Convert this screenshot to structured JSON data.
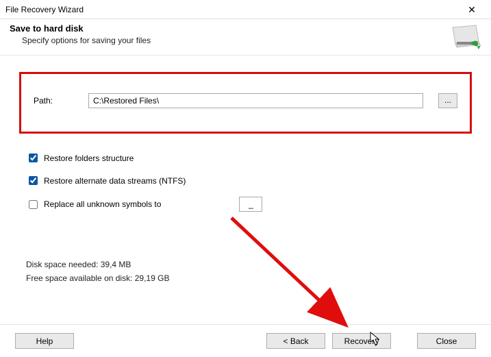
{
  "window": {
    "title": "File Recovery Wizard"
  },
  "header": {
    "title": "Save to hard disk",
    "subtitle": "Specify options for saving your files"
  },
  "path": {
    "label": "Path:",
    "value": "C:\\Restored Files\\",
    "browse_label": "..."
  },
  "options": {
    "restore_folders": {
      "label": "Restore folders structure",
      "checked": true
    },
    "restore_ads": {
      "label": "Restore alternate data streams (NTFS)",
      "checked": true
    },
    "replace_symbols": {
      "label": "Replace all unknown symbols to",
      "checked": false,
      "value": "_"
    }
  },
  "disk": {
    "needed": "Disk space needed: 39,4 MB",
    "free": "Free space available on disk: 29,19 GB"
  },
  "buttons": {
    "help": "Help",
    "back": "< Back",
    "recovery": "Recovery",
    "close": "Close"
  }
}
